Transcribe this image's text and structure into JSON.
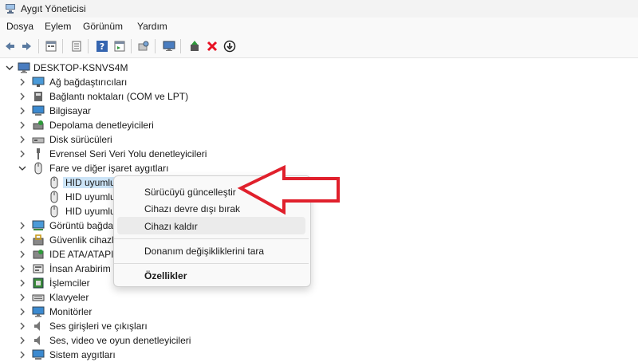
{
  "window": {
    "title": "Aygıt Yöneticisi"
  },
  "menu": {
    "items": [
      "Dosya",
      "Eylem",
      "Görünüm",
      "Yardım"
    ]
  },
  "toolbar": {
    "buttons": [
      "back-icon",
      "forward-icon",
      "properties-icon",
      "view-icon",
      "help-icon",
      "list-icon",
      "scan-icon",
      "monitor-icon",
      "update-driver-icon",
      "remove-icon",
      "disable-icon"
    ]
  },
  "tree": {
    "root": "DESKTOP-KSNVS4M",
    "categories": [
      "Ağ bağdaştırıcıları",
      "Bağlantı noktaları (COM ve LPT)",
      "Bilgisayar",
      "Depolama denetleyicileri",
      "Disk sürücüleri",
      "Evrensel Seri Veri Yolu denetleyicileri",
      "Fare ve diğer işaret aygıtları",
      "Görüntü bağda",
      "Güvenlik cihazl",
      "IDE ATA/ATAPI d",
      "İnsan Arabirim",
      "İşlemciler",
      "Klavyeler",
      "Monitörler",
      "Ses girişleri ve çıkışları",
      "Ses, video ve oyun denetleyicileri",
      "Sistem aygıtları"
    ],
    "expanded_children": [
      "HID uyumlu",
      "HID uyumlu",
      "HID uyumlu"
    ]
  },
  "context_menu": {
    "items": [
      "Sürücüyü güncelleştir",
      "Cihazı devre dışı bırak",
      "Cihazı kaldır",
      "Donanım değişikliklerini tara",
      "Özellikler"
    ]
  },
  "colors": {
    "arrow": "#e0202c",
    "selection": "#cce4f7",
    "remove": "#e81123"
  }
}
